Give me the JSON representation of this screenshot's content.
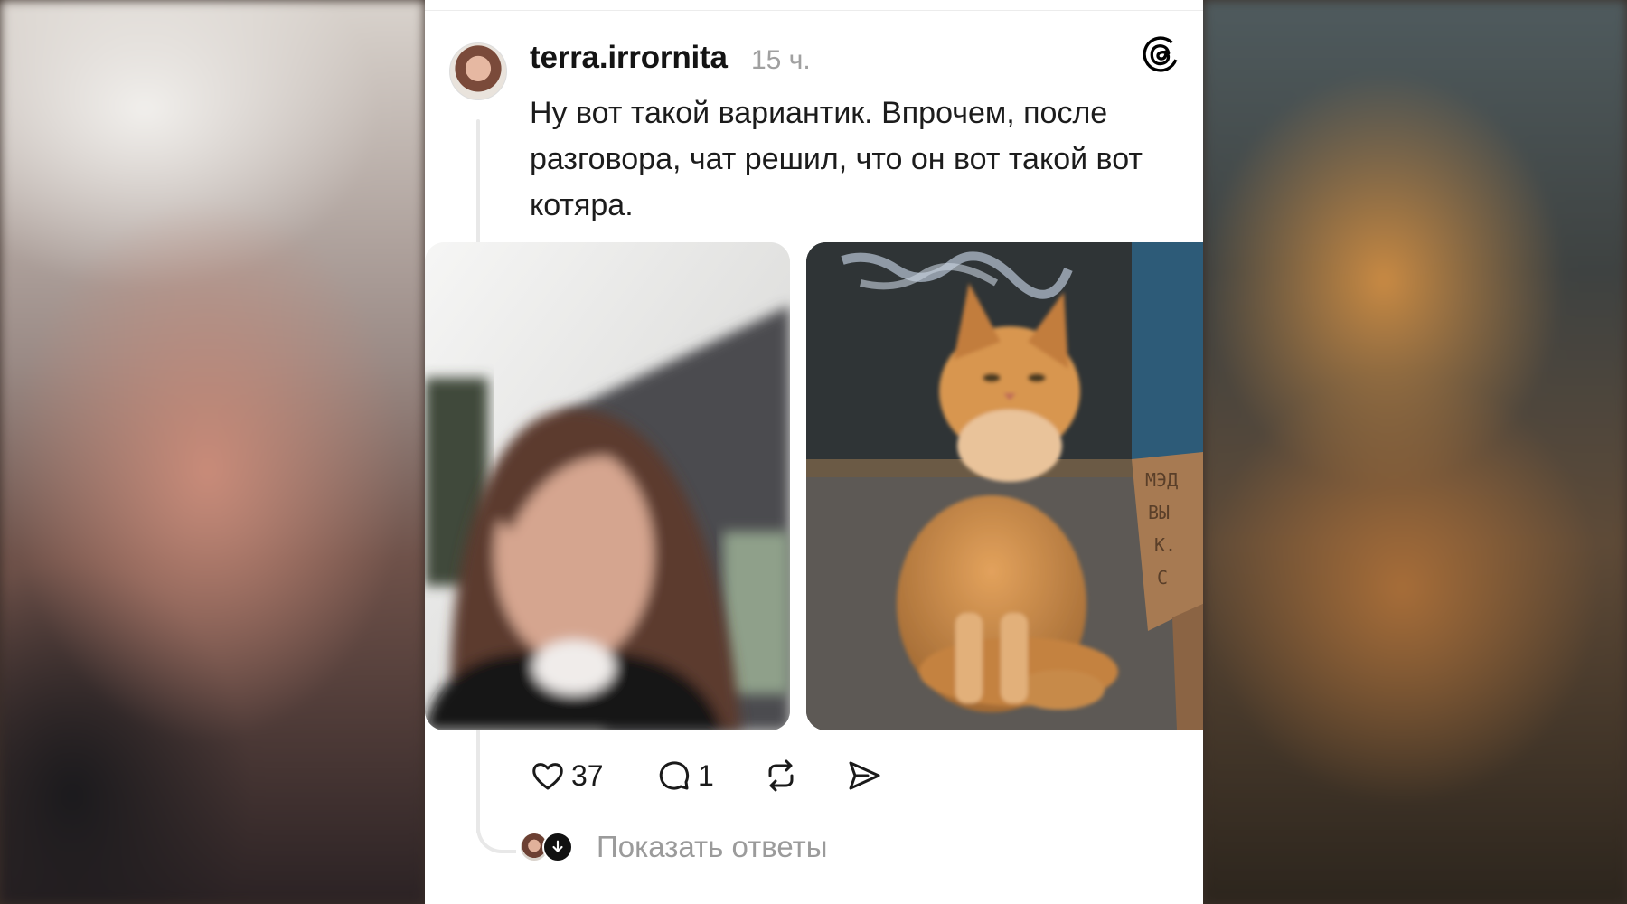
{
  "post": {
    "username": "terra.irrornita",
    "time": "15 ч.",
    "text": "Ну вот такой вариантик. Впрочем, после разговора, чат решил, что он вот такой вот котяра.",
    "images": [
      "selfie-photo",
      "ginger-cat-photo"
    ],
    "sign_text": [
      "МЭД",
      "ВЫ",
      "К.",
      "С"
    ]
  },
  "actions": {
    "likes": "37",
    "replies": "1"
  },
  "show_replies_label": "Показать ответы",
  "icons": [
    "threads-logo-icon",
    "heart-icon",
    "comment-icon",
    "repost-icon",
    "share-icon",
    "arrow-down-icon"
  ],
  "colors": {
    "text": "#1c1c1c",
    "muted": "#9b9b9b",
    "card": "#ffffff"
  }
}
